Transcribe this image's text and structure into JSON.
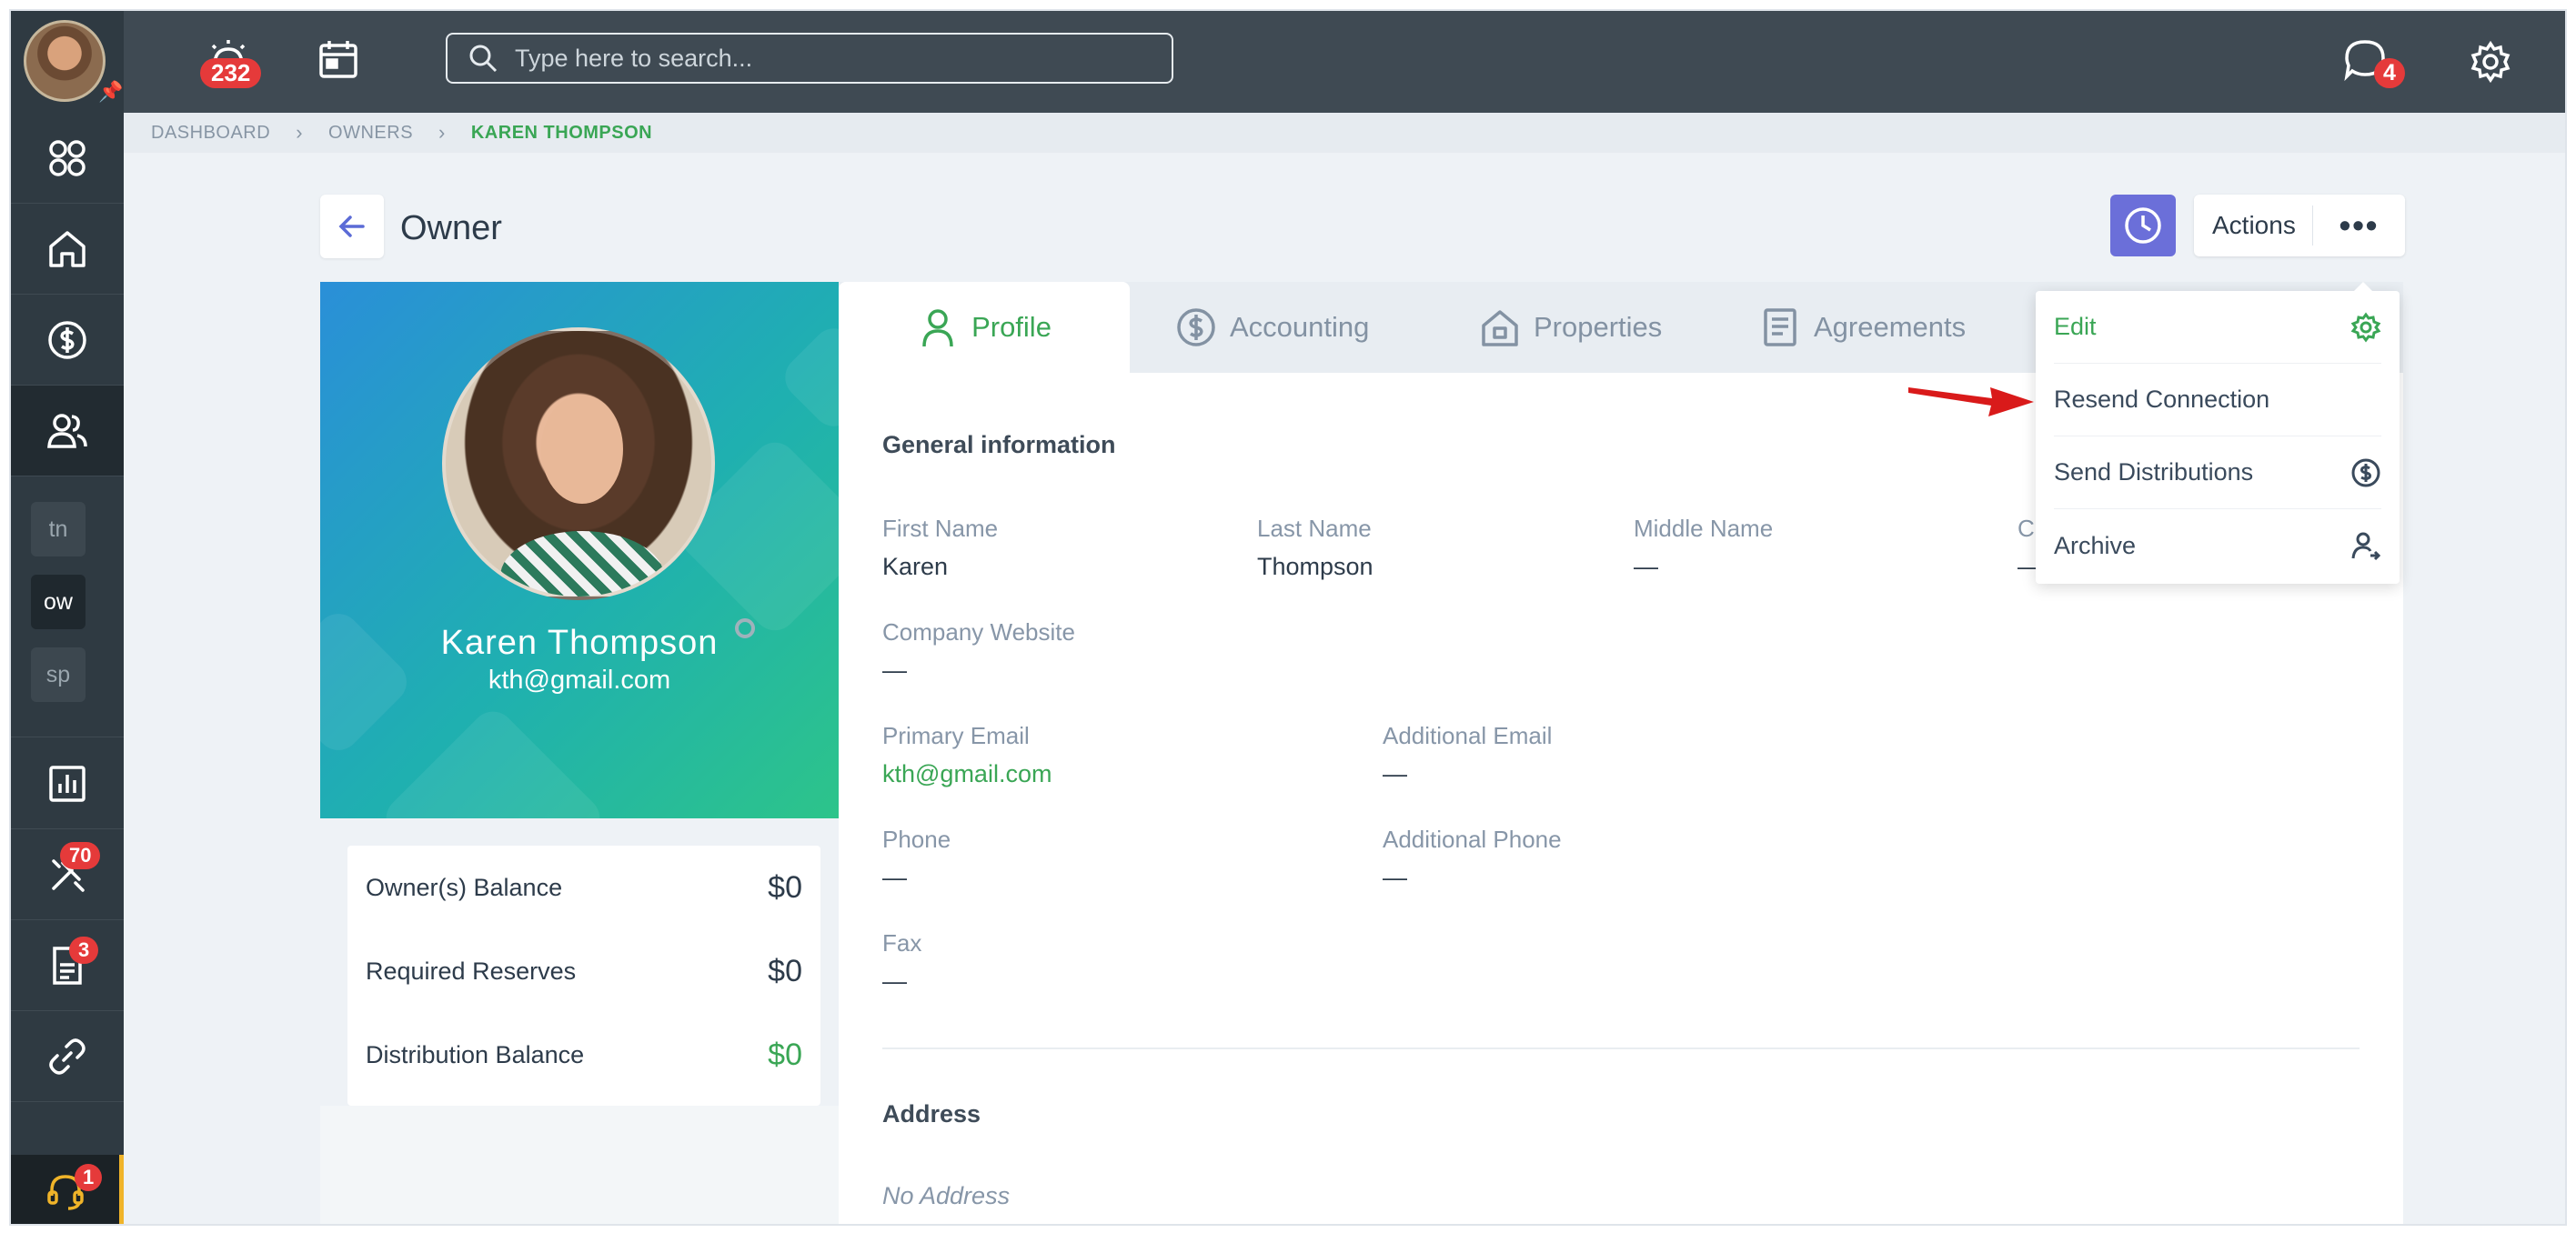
{
  "topbar": {
    "alarm_count": "232",
    "search_placeholder": "Type here to search...",
    "chat_count": "4"
  },
  "rail": {
    "mini_items": [
      "tn",
      "ow",
      "sp"
    ],
    "tools_badge": "70",
    "docs_badge": "3",
    "help_badge": "1"
  },
  "breadcrumb": [
    "DASHBOARD",
    "OWNERS",
    "KAREN THOMPSON"
  ],
  "page": {
    "title": "Owner"
  },
  "actions": {
    "label": "Actions",
    "more": "•••"
  },
  "profile": {
    "name": "Karen Thompson",
    "email": "kth@gmail.com"
  },
  "balances": [
    {
      "label": "Owner(s) Balance",
      "value": "$0"
    },
    {
      "label": "Required Reserves",
      "value": "$0"
    },
    {
      "label": "Distribution Balance",
      "value": "$0"
    }
  ],
  "tabs": [
    "Profile",
    "Accounting",
    "Properties",
    "Agreements"
  ],
  "general": {
    "title": "General information",
    "first_name_label": "First Name",
    "first_name": "Karen",
    "last_name_label": "Last Name",
    "last_name": "Thompson",
    "middle_name_label": "Middle Name",
    "middle_name": "—",
    "partial_label": "C",
    "partial_value": "—",
    "company_website_label": "Company Website",
    "company_website": "—",
    "primary_email_label": "Primary Email",
    "primary_email": "kth@gmail.com",
    "additional_email_label": "Additional Email",
    "additional_email": "—",
    "phone_label": "Phone",
    "phone": "—",
    "additional_phone_label": "Additional Phone",
    "additional_phone": "—",
    "fax_label": "Fax",
    "fax": "—"
  },
  "address": {
    "title": "Address",
    "value": "No Address"
  },
  "menu": [
    "Edit",
    "Resend Connection",
    "Send Distributions",
    "Archive"
  ],
  "colors": {
    "accent_green": "#3aa655",
    "purple": "#6b6fd9",
    "badge_red": "#e53a3a",
    "arrow_red": "#d91a1a"
  }
}
